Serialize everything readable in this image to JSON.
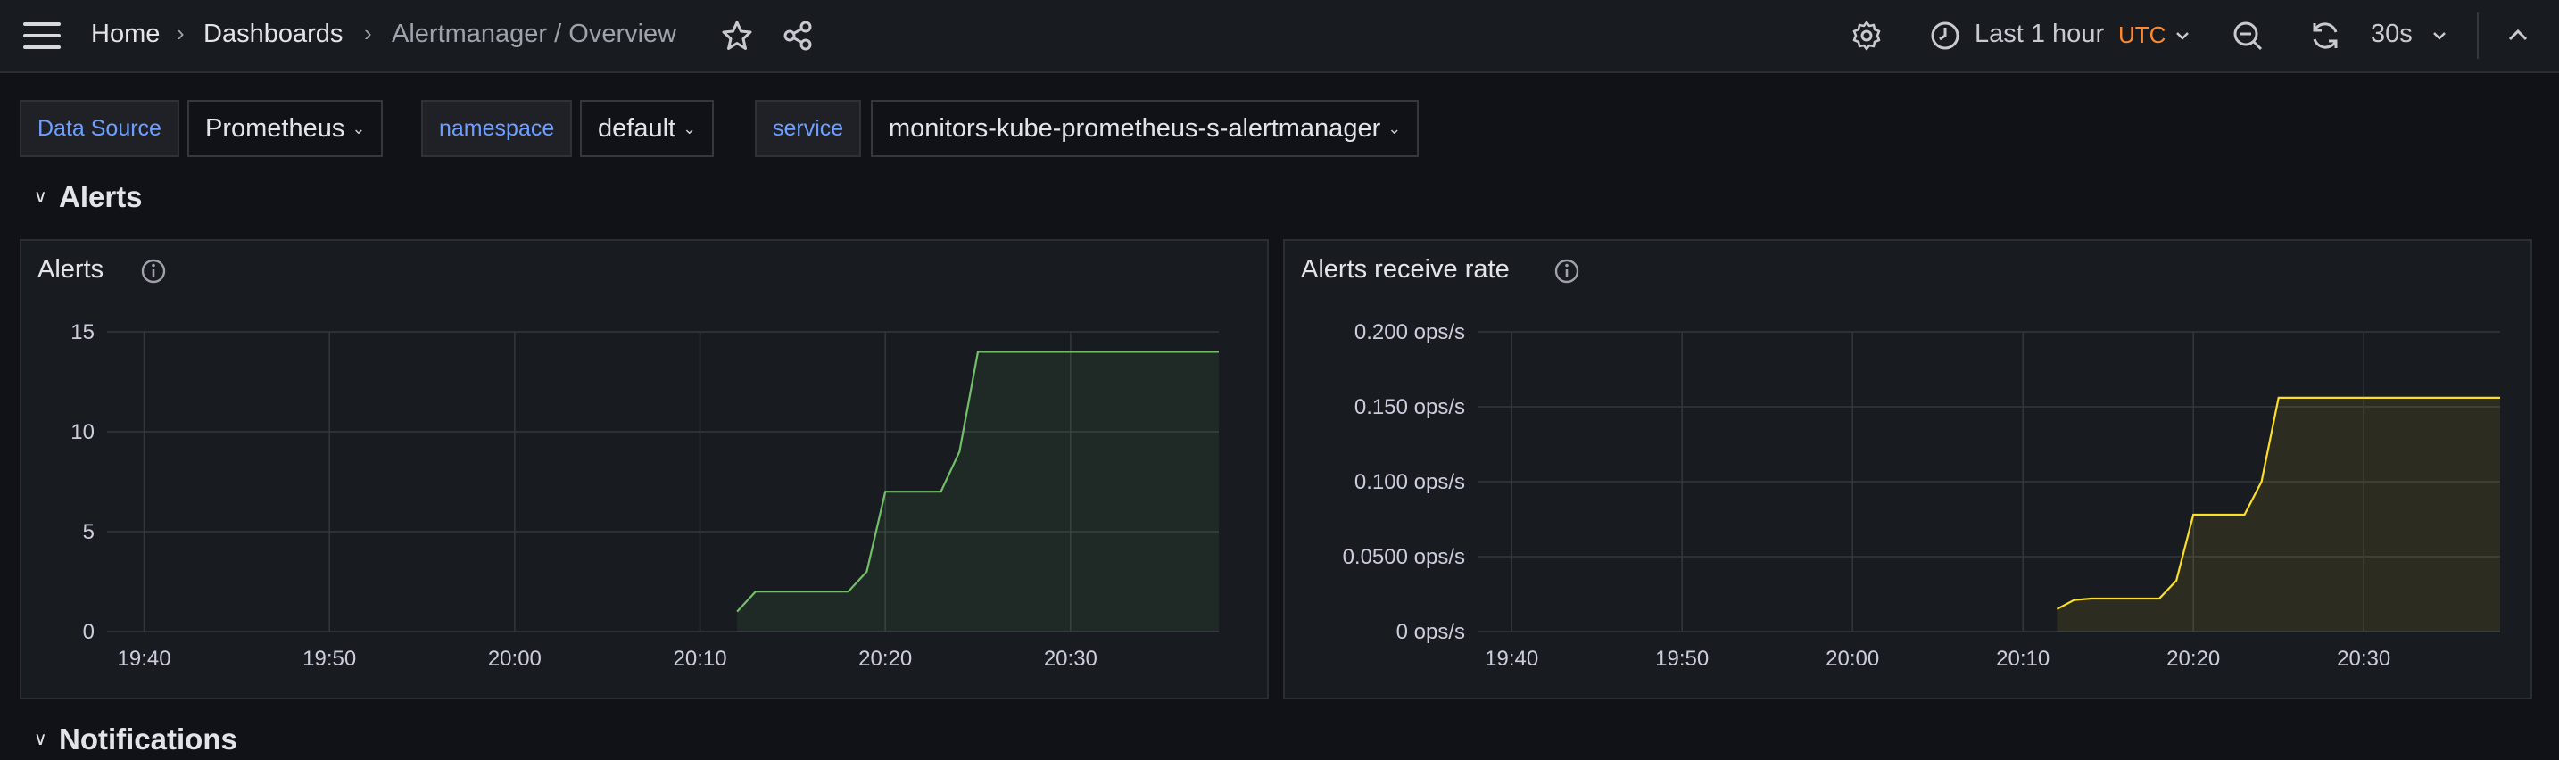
{
  "nav": {
    "breadcrumbs": [
      "Home",
      "Dashboards",
      "Alertmanager / Overview"
    ],
    "separator": "›"
  },
  "toolbar": {
    "time_range": "Last 1 hour",
    "timezone": "UTC",
    "refresh_interval": "30s",
    "icons": [
      "menu-icon",
      "star-icon",
      "share-icon",
      "gear-icon",
      "clock-icon",
      "zoom-out-icon",
      "refresh-icon",
      "chevron-up-icon"
    ]
  },
  "variables": [
    {
      "label": "Data Source",
      "value": "Prometheus"
    },
    {
      "label": "namespace",
      "value": "default"
    },
    {
      "label": "service",
      "value": "monitors-kube-prometheus-s-alertmanager"
    }
  ],
  "rows": {
    "alerts": "Alerts",
    "notifications": "Notifications"
  },
  "colors": {
    "background": "#111217",
    "panel": "#181b1f",
    "green_series": "#73bf69",
    "yellow_series": "#fade2a",
    "accent_blue": "#6e9fff",
    "utc_orange": "#ff8833"
  },
  "chart_data": [
    {
      "type": "area",
      "title": "Alerts",
      "x_ticks": [
        "19:40",
        "19:50",
        "20:00",
        "20:10",
        "20:20",
        "20:30"
      ],
      "y_ticks": [
        "0",
        "5",
        "10",
        "15"
      ],
      "ylim": [
        0,
        15
      ],
      "xlim": [
        "19:38",
        "20:38"
      ],
      "grid": true,
      "series": [
        {
          "color": "#73bf69",
          "points": [
            [
              "20:12",
              1
            ],
            [
              "20:13",
              2
            ],
            [
              "20:18",
              2
            ],
            [
              "20:19",
              3
            ],
            [
              "20:20",
              7
            ],
            [
              "20:23",
              7
            ],
            [
              "20:24",
              9
            ],
            [
              "20:25",
              14
            ],
            [
              "20:38",
              14
            ]
          ]
        }
      ]
    },
    {
      "type": "area",
      "title": "Alerts receive rate",
      "x_ticks": [
        "19:40",
        "19:50",
        "20:00",
        "20:10",
        "20:20",
        "20:30"
      ],
      "y_ticks": [
        "0 ops/s",
        "0.0500 ops/s",
        "0.100 ops/s",
        "0.150 ops/s",
        "0.200 ops/s"
      ],
      "ylim": [
        0,
        0.2
      ],
      "xlim": [
        "19:38",
        "20:38"
      ],
      "grid": true,
      "series": [
        {
          "color": "#fade2a",
          "points": [
            [
              "20:12",
              0.015
            ],
            [
              "20:13",
              0.021
            ],
            [
              "20:14",
              0.022
            ],
            [
              "20:18",
              0.022
            ],
            [
              "20:19",
              0.034
            ],
            [
              "20:20",
              0.078
            ],
            [
              "20:23",
              0.078
            ],
            [
              "20:24",
              0.1
            ],
            [
              "20:25",
              0.156
            ],
            [
              "20:38",
              0.156
            ]
          ]
        }
      ]
    }
  ]
}
